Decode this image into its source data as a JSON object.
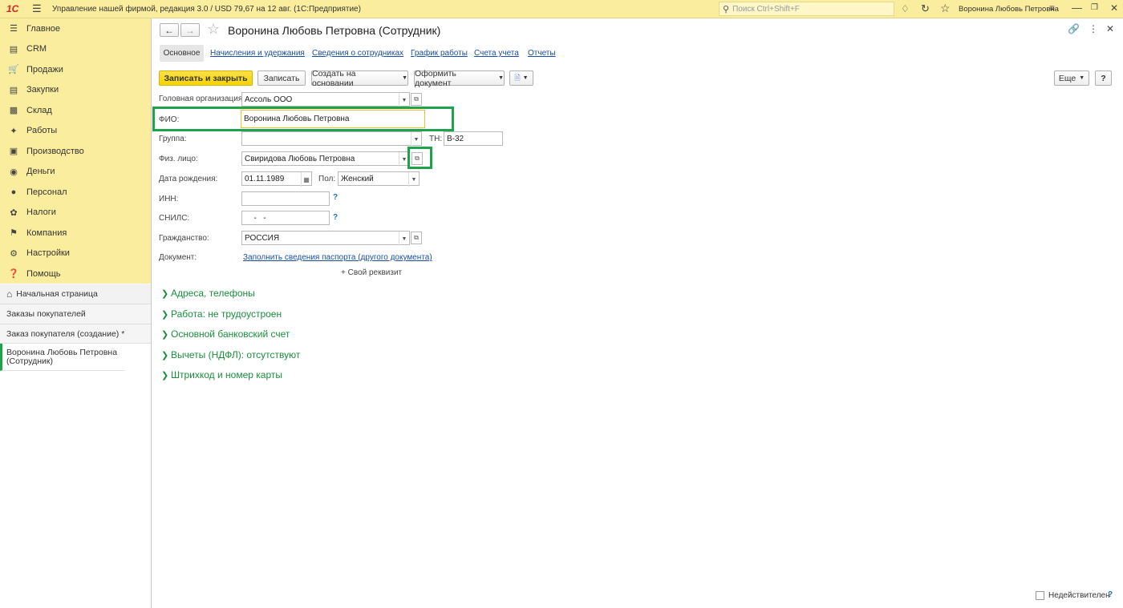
{
  "titlebar": {
    "logo": "1С",
    "title": "Управление нашей фирмой, редакция 3.0 / USD 79,67 на 12 авг.  (1С:Предприятие)",
    "search_placeholder": "Поиск Ctrl+Shift+F",
    "user": "Воронина Любовь Петровна"
  },
  "sidebar": {
    "sections": [
      {
        "label": "Главное",
        "icon": "menu-icon"
      },
      {
        "label": "CRM",
        "icon": "crm-icon"
      },
      {
        "label": "Продажи",
        "icon": "sales-icon"
      },
      {
        "label": "Закупки",
        "icon": "purchases-icon"
      },
      {
        "label": "Склад",
        "icon": "warehouse-icon"
      },
      {
        "label": "Работы",
        "icon": "tools-icon"
      },
      {
        "label": "Производство",
        "icon": "factory-icon"
      },
      {
        "label": "Деньги",
        "icon": "money-icon"
      },
      {
        "label": "Персонал",
        "icon": "person-icon"
      },
      {
        "label": "Налоги",
        "icon": "tax-icon"
      },
      {
        "label": "Компания",
        "icon": "flag-icon"
      },
      {
        "label": "Настройки",
        "icon": "gear-icon"
      },
      {
        "label": "Помощь",
        "icon": "help-icon"
      }
    ],
    "home": "Начальная страница",
    "open_windows": [
      "Заказы покупателей",
      "Заказ покупателя (создание) *",
      "Воронина Любовь Петровна (Сотрудник)"
    ]
  },
  "form": {
    "title": "Воронина Любовь Петровна (Сотрудник)",
    "tabs": [
      "Основное",
      "Начисления и удержания",
      "Сведения о сотрудниках",
      "График работы",
      "Счета учета",
      "Отчеты"
    ],
    "toolbar": {
      "save_close": "Записать и закрыть",
      "save": "Записать",
      "create_based": "Создать на основании",
      "format_doc": "Оформить документ",
      "more": "Еще",
      "help": "?"
    },
    "fields": {
      "head_org_label": "Головная организация:",
      "head_org_value": "Ассоль ООО",
      "fio_label": "ФИО:",
      "fio_value": "Воронина Любовь Петровна",
      "group_label": "Группа:",
      "group_value": "",
      "tn_label": "ТН:",
      "tn_value": "В-32",
      "person_label": "Физ. лицо:",
      "person_value": "Свиридова Любовь Петровна",
      "birth_label": "Дата рождения:",
      "birth_value": "01.11.1989",
      "gender_label": "Пол:",
      "gender_value": "Женский",
      "inn_label": "ИНН:",
      "inn_value": "",
      "snils_label": "СНИЛС:",
      "snils_value": "  -   -",
      "citizenship_label": "Гражданство:",
      "citizenship_value": "РОССИЯ",
      "document_label": "Документ:",
      "document_link": "Заполнить сведения паспорта (другого документа)",
      "custom_attr": "+ Свой реквизит",
      "q": "?"
    },
    "groups": [
      "Адреса, телефоны",
      "Работа: не трудоустроен",
      "Основной банковский счет",
      "Вычеты (НДФЛ): отсутствуют",
      "Штрихкод и номер карты"
    ],
    "inactive_label": "Недействителен",
    "inactive_checked": false
  },
  "colors": {
    "titlebar_bg": "#fbed9e",
    "primary_button": "#f5d400",
    "group_text": "#1a8f3d",
    "highlight_box": "#1ea34a",
    "link": "#1a4fa3"
  }
}
